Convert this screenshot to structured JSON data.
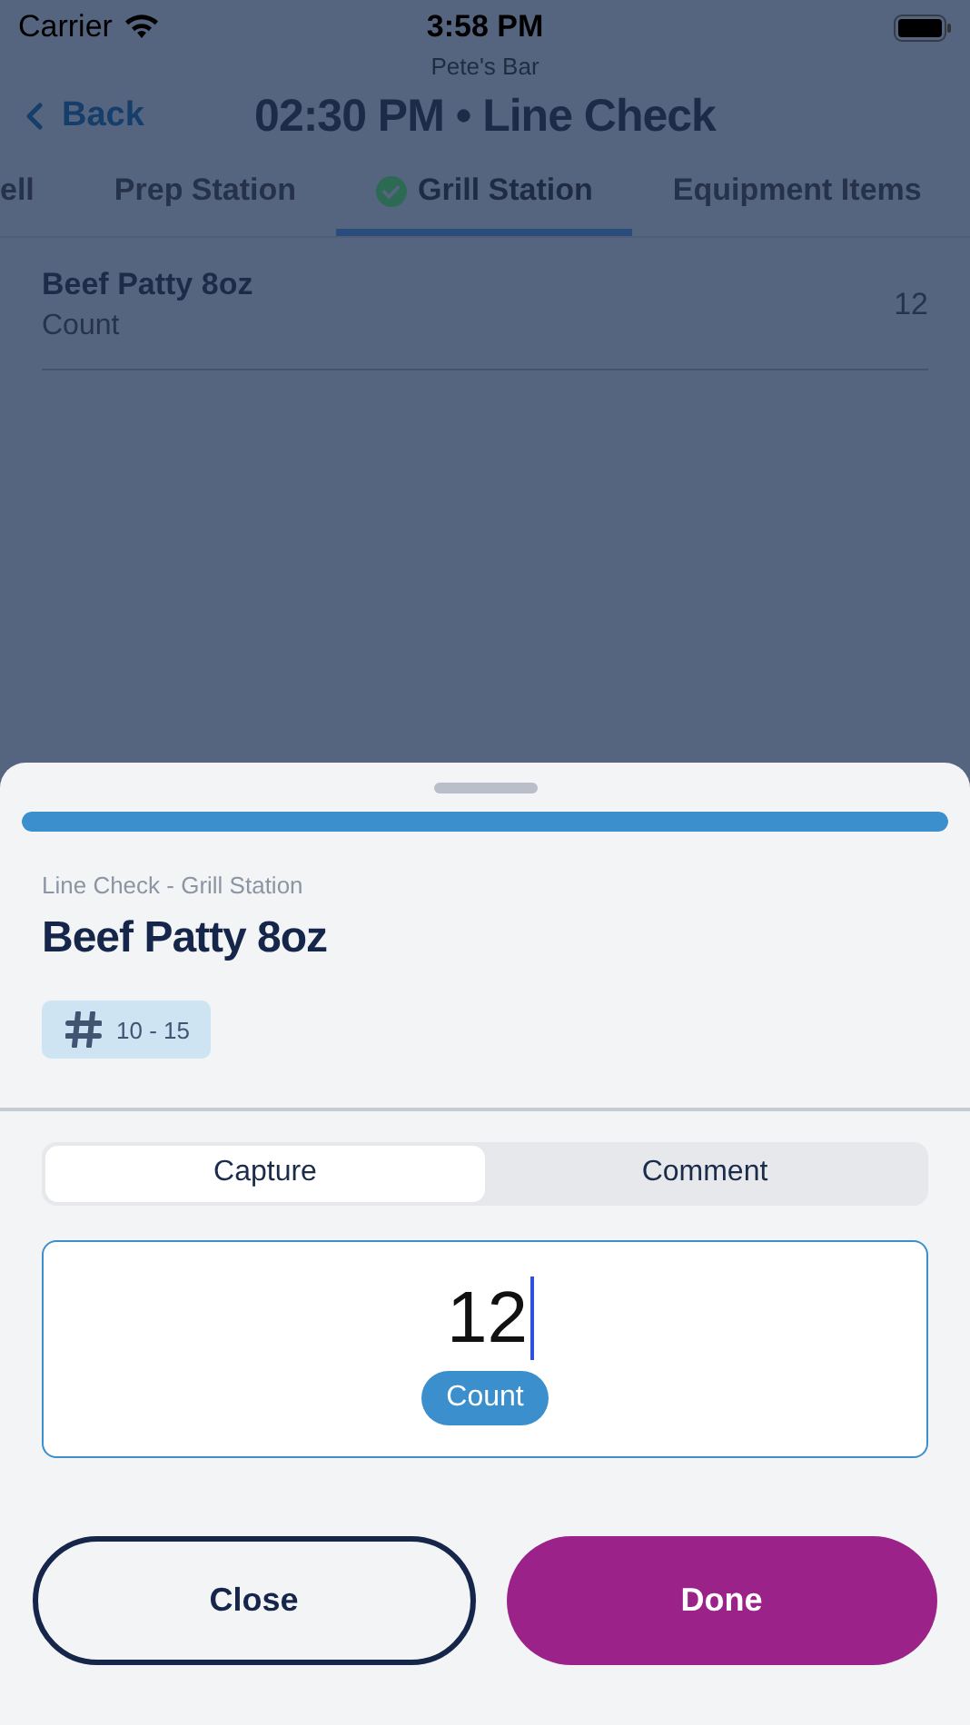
{
  "status_bar": {
    "carrier": "Carrier",
    "time": "3:58 PM"
  },
  "header": {
    "subtitle": "Pete's Bar",
    "back": "Back",
    "title": "02:30 PM • Line Check"
  },
  "tabs": [
    {
      "label": "ell",
      "selected": false,
      "completed": false
    },
    {
      "label": "Prep Station",
      "selected": false,
      "completed": false
    },
    {
      "label": "Grill Station",
      "selected": true,
      "completed": true
    },
    {
      "label": "Equipment Items",
      "selected": false,
      "completed": false
    }
  ],
  "items": [
    {
      "name": "Beef Patty 8oz",
      "unit": "Count",
      "value": "12"
    }
  ],
  "sheet": {
    "progress": {
      "level": 1
    },
    "breadcrumb": "Line Check - Grill Station",
    "title": "Beef Patty 8oz",
    "range": "10 - 15",
    "segments": [
      {
        "label": "Capture",
        "selected": true
      },
      {
        "label": "Comment",
        "selected": false
      }
    ],
    "input": {
      "value": "12",
      "unit": "Count"
    },
    "buttons": [
      {
        "label": "Close",
        "kind": "secondary"
      },
      {
        "label": "Done",
        "kind": "primary"
      }
    ]
  }
}
